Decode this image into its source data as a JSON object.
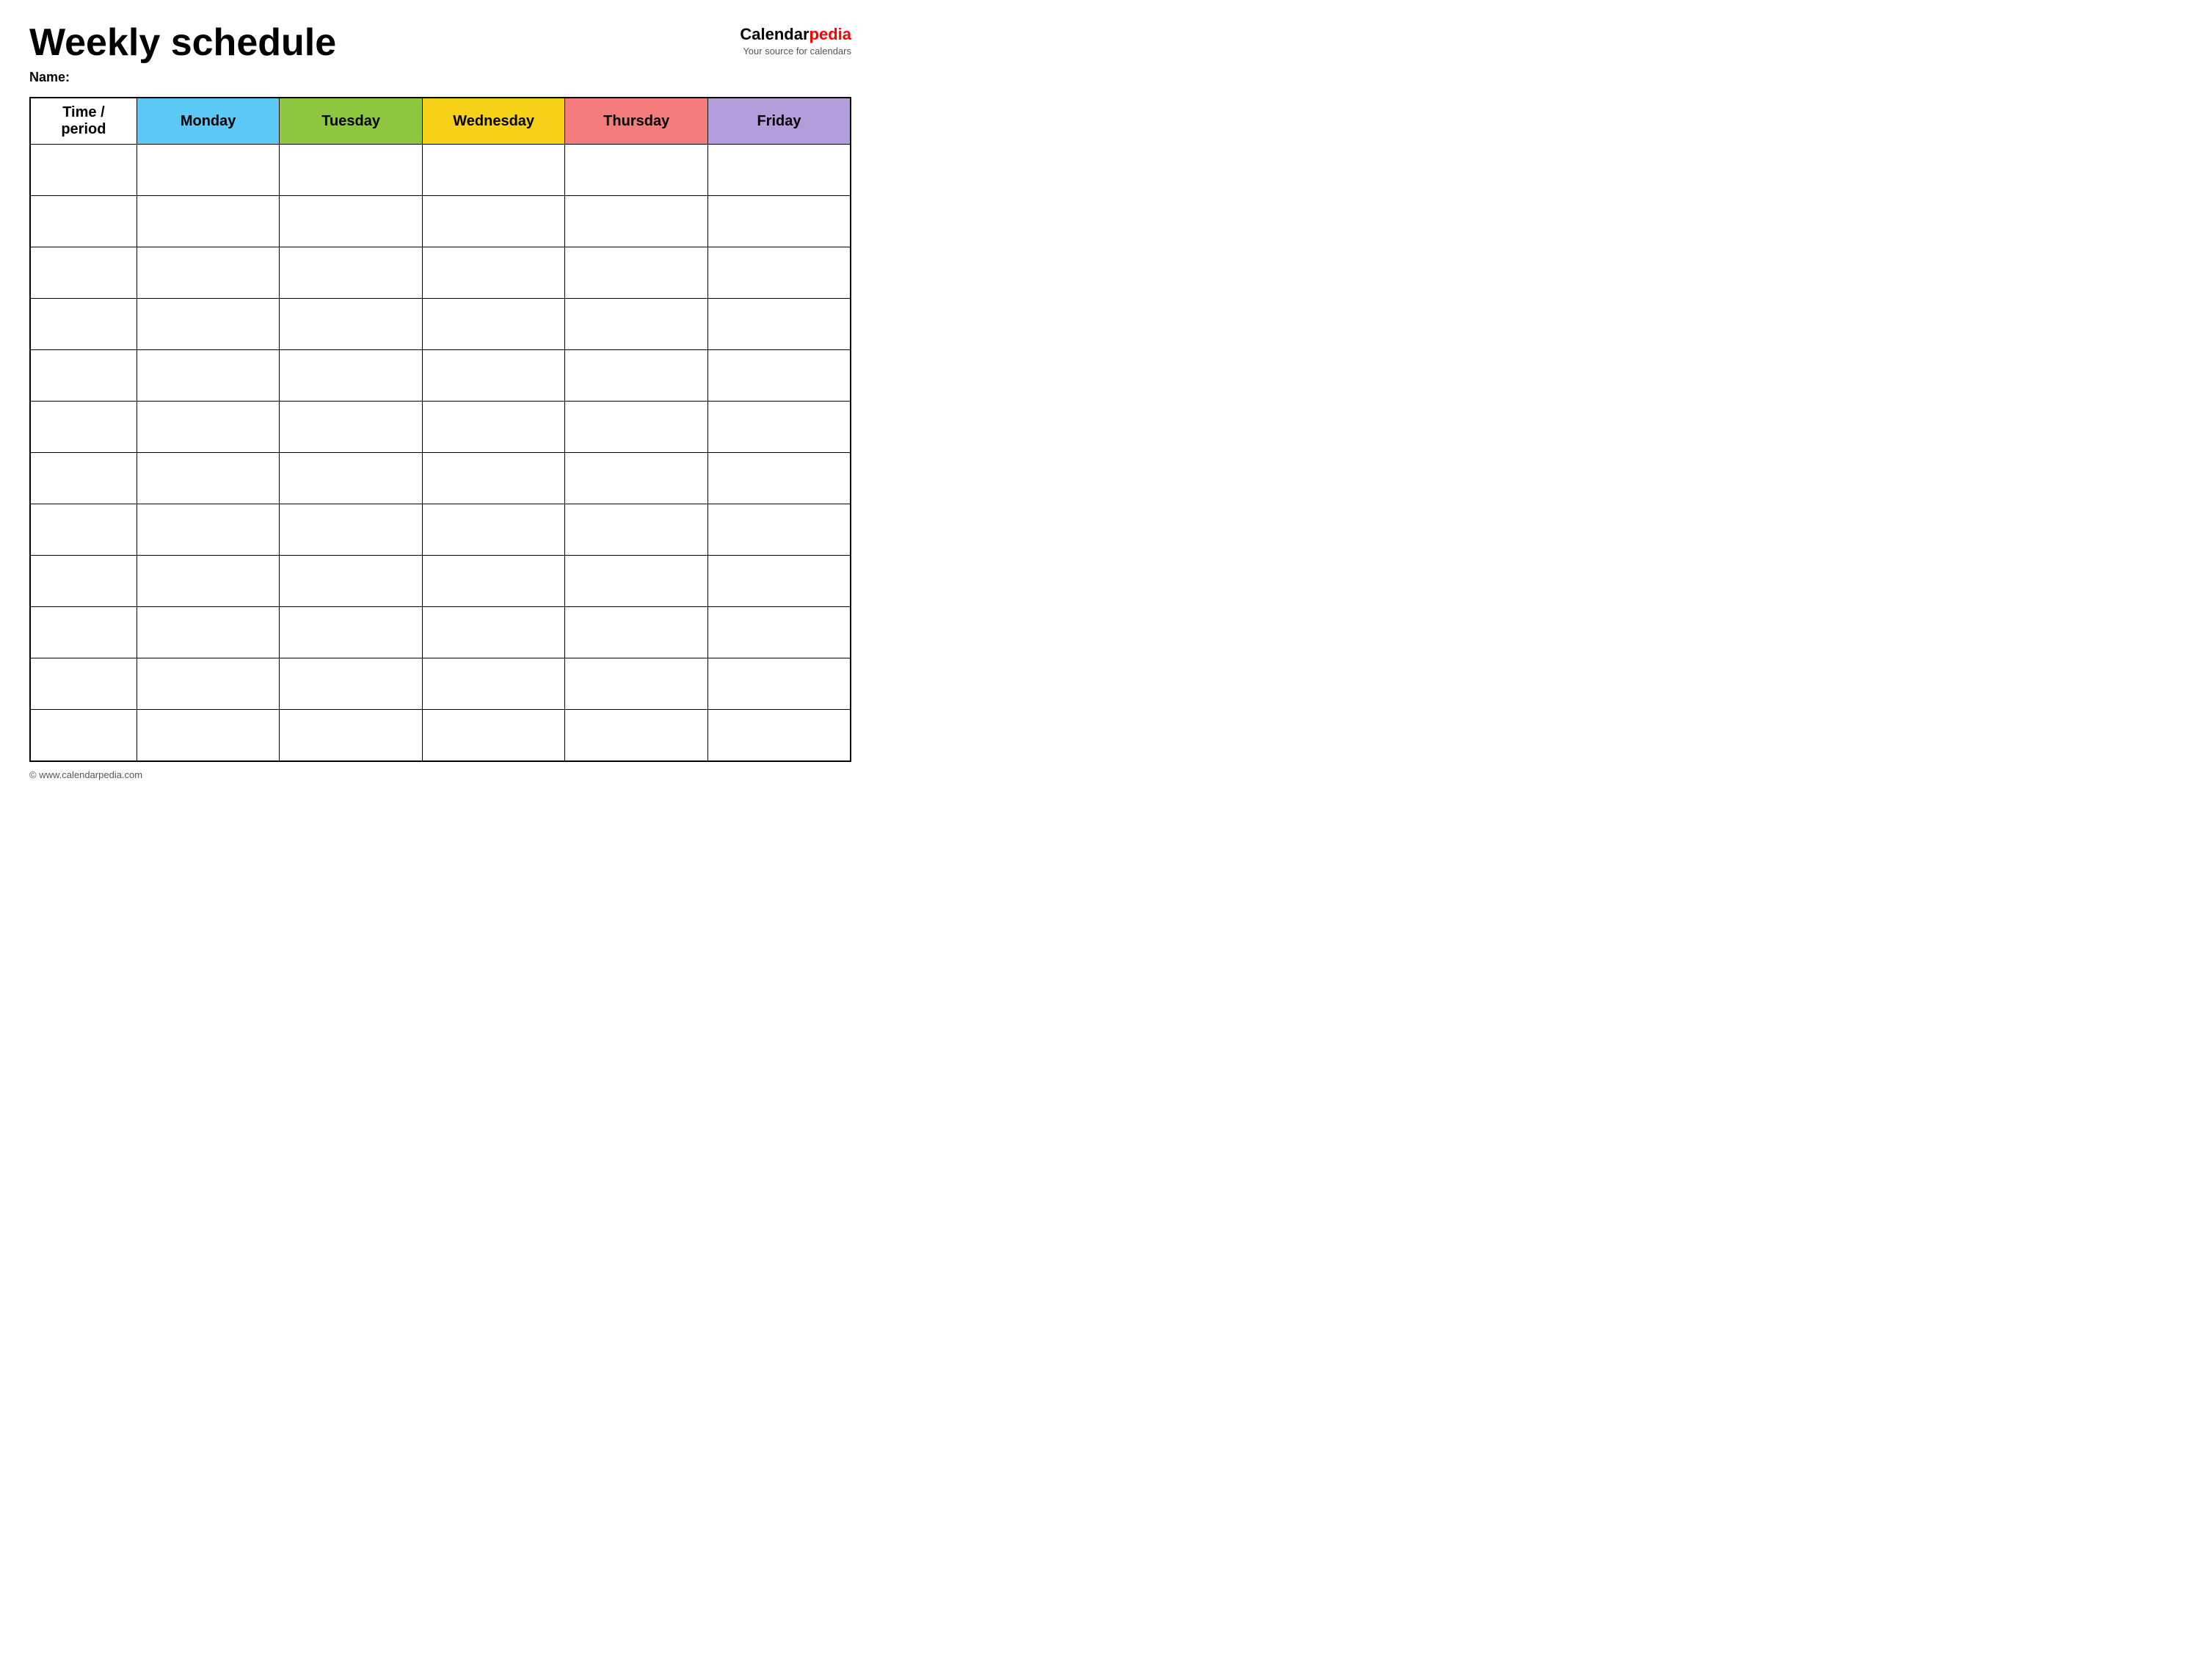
{
  "header": {
    "title": "Weekly schedule",
    "logo_calendar": "Calendar",
    "logo_pedia": "pedia",
    "logo_subtitle": "Your source for calendars"
  },
  "name_label": "Name:",
  "table": {
    "columns": [
      {
        "label": "Time / period",
        "class": "th-time"
      },
      {
        "label": "Monday",
        "class": "th-monday"
      },
      {
        "label": "Tuesday",
        "class": "th-tuesday"
      },
      {
        "label": "Wednesday",
        "class": "th-wednesday"
      },
      {
        "label": "Thursday",
        "class": "th-thursday"
      },
      {
        "label": "Friday",
        "class": "th-friday"
      }
    ],
    "rows": 12
  },
  "footer": {
    "text": "© www.calendarpedia.com"
  }
}
